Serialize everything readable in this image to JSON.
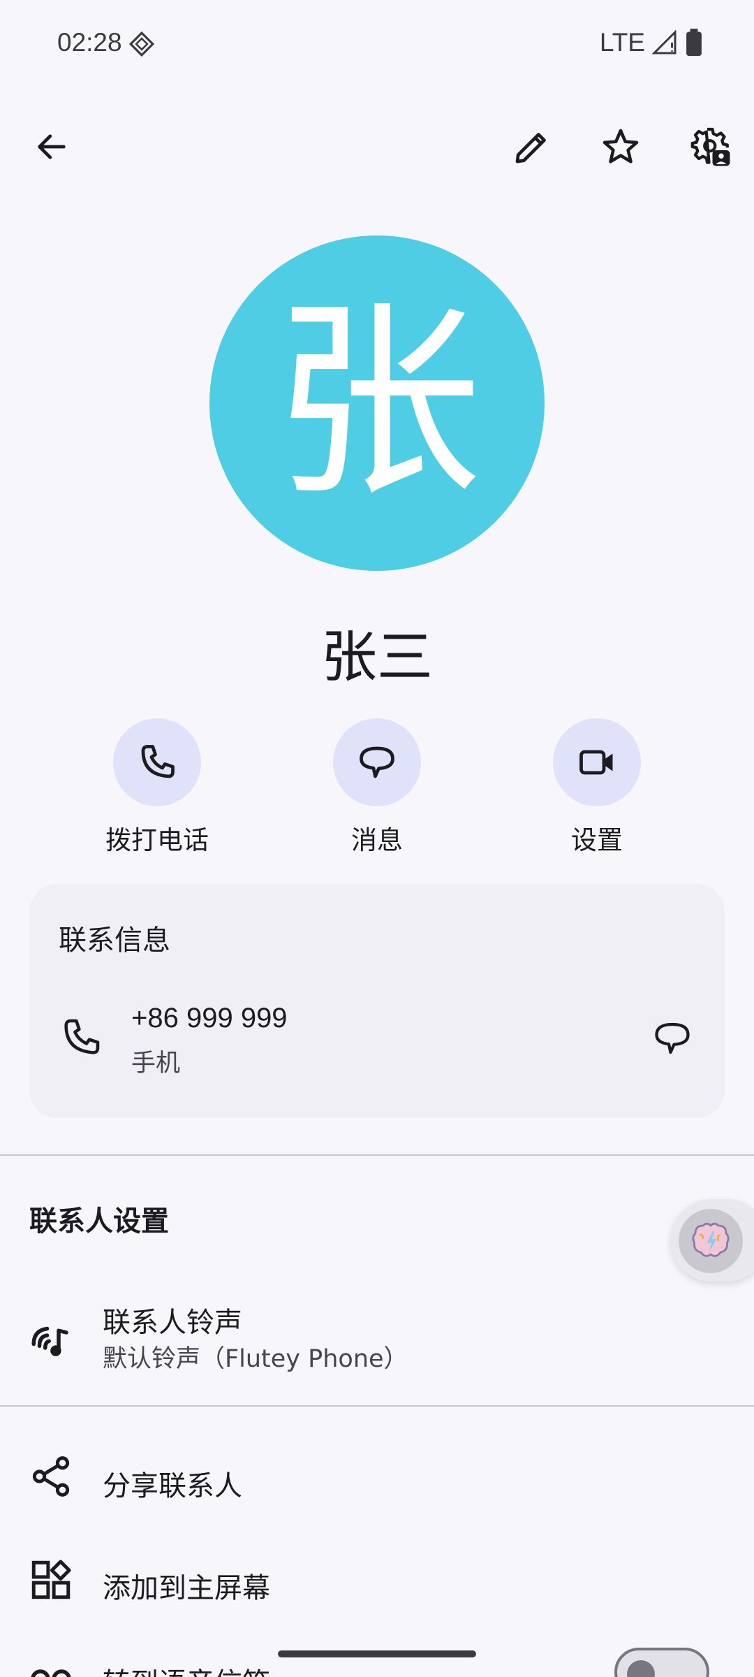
{
  "status_bar": {
    "time": "02:28",
    "network": "LTE"
  },
  "toolbar": {
    "back_icon": "arrow-back-icon",
    "edit_icon": "edit-pencil-icon",
    "favorite_icon": "star-outline-icon",
    "settings_icon": "contact-settings-icon"
  },
  "contact": {
    "avatar_letter": "张",
    "avatar_color": "#4ecde5",
    "name": "张三"
  },
  "actions": [
    {
      "label": "拨打电话",
      "icon": "phone-icon"
    },
    {
      "label": "消息",
      "icon": "message-icon"
    },
    {
      "label": "设置",
      "icon": "video-icon"
    }
  ],
  "contact_info": {
    "title": "联系信息",
    "phone_number": "+86 999 999",
    "phone_type": "手机"
  },
  "contact_settings": {
    "title": "联系人设置",
    "ringtone_title": "联系人铃声",
    "ringtone_value": "默认铃声（Flutey Phone）",
    "share_label": "分享联系人",
    "add_home_label": "添加到主屏幕",
    "voicemail_label": "转到语音信箱"
  },
  "colors": {
    "background": "#f7f6fb",
    "accent_circle": "#dfe2f8",
    "card": "#efeff5"
  }
}
